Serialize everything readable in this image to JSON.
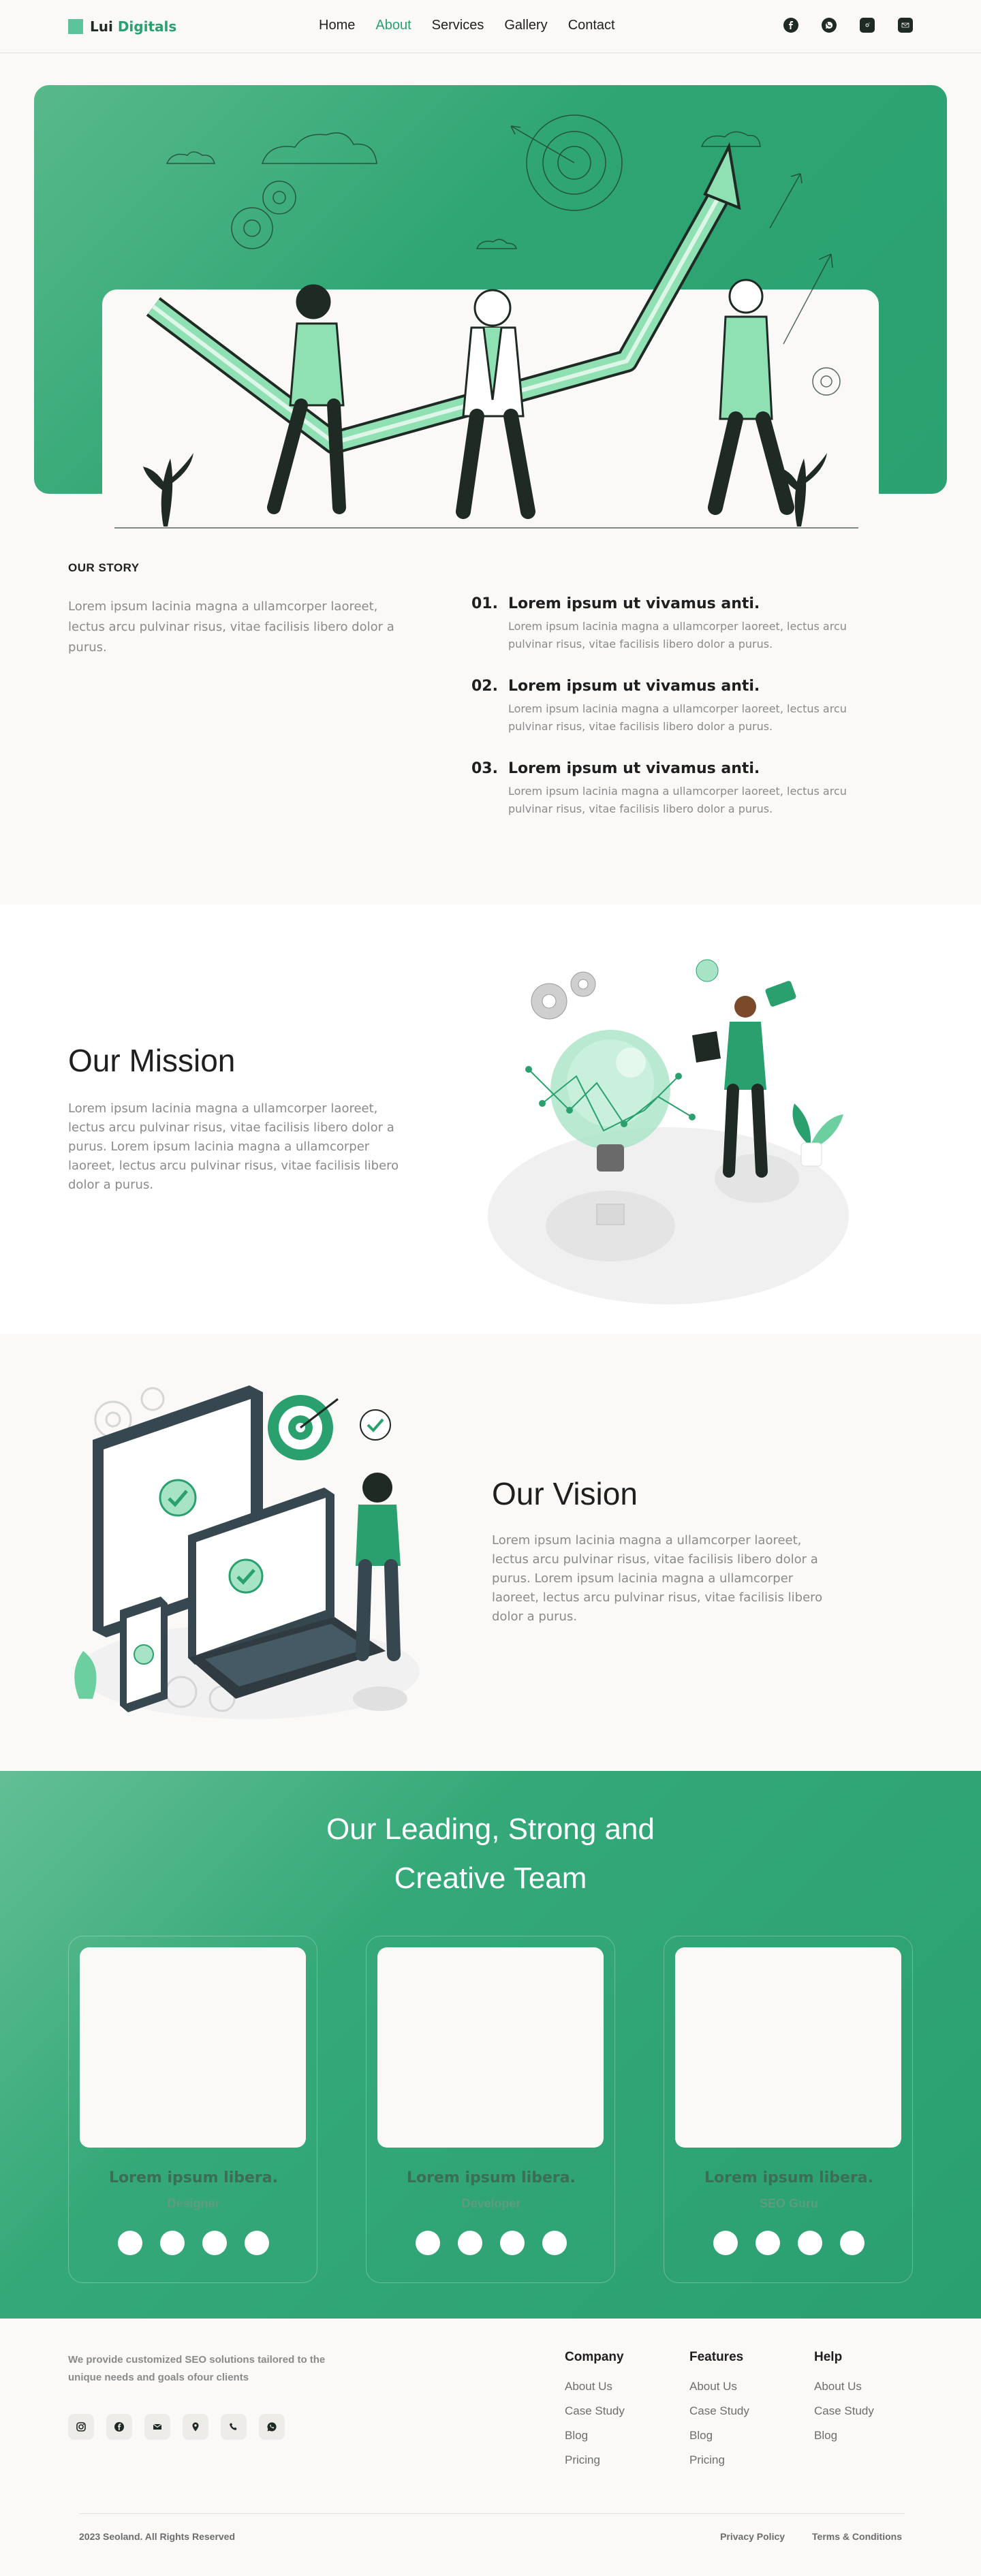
{
  "nav": {
    "logo_prefix": "Lui ",
    "logo_suffix": "Digitals",
    "links": [
      "Home",
      "About",
      "Services",
      "Gallery",
      "Contact"
    ],
    "active": "About",
    "social_icons": [
      "facebook-icon",
      "whatsapp-icon",
      "instagram-icon",
      "mail-icon"
    ]
  },
  "story": {
    "eyebrow": "OUR STORY",
    "text": "Lorem ipsum lacinia magna a ullamcorper laoreet, lectus arcu pulvinar risus, vitae facilisis libero dolor a purus.",
    "items": [
      {
        "num": "01.",
        "title": "Lorem ipsum ut vivamus anti.",
        "body": "Lorem ipsum lacinia magna a ullamcorper laoreet, lectus arcu pulvinar risus, vitae facilisis libero dolor a purus."
      },
      {
        "num": "02.",
        "title": "Lorem ipsum ut vivamus anti.",
        "body": "Lorem ipsum lacinia magna a ullamcorper laoreet, lectus arcu pulvinar risus, vitae facilisis libero dolor a purus."
      },
      {
        "num": "03.",
        "title": "Lorem ipsum ut vivamus anti.",
        "body": "Lorem ipsum lacinia magna a ullamcorper laoreet, lectus arcu pulvinar risus, vitae facilisis libero dolor a purus."
      }
    ]
  },
  "mission": {
    "title": "Our Mission",
    "text": "Lorem ipsum lacinia magna a ullamcorper laoreet, lectus arcu pulvinar risus, vitae facilisis libero dolor a purus. Lorem ipsum lacinia magna a ullamcorper laoreet, lectus arcu pulvinar risus, vitae facilisis libero dolor a purus."
  },
  "vision": {
    "title": "Our Vision",
    "text": "Lorem ipsum lacinia magna a ullamcorper laoreet, lectus arcu pulvinar risus, vitae facilisis libero dolor a purus. Lorem ipsum lacinia magna a ullamcorper laoreet, lectus arcu pulvinar risus, vitae facilisis libero dolor a purus."
  },
  "team": {
    "title_line1": "Our Leading, Strong and",
    "title_line2": "Creative Team",
    "members": [
      {
        "name": "Lorem ipsum libera.",
        "role": "Designer"
      },
      {
        "name": "Lorem ipsum libera.",
        "role": "Developer"
      },
      {
        "name": "Lorem ipsum libera.",
        "role": "SEO Guru"
      }
    ]
  },
  "footer": {
    "tagline": "We provide customized SEO solutions tailored to the unique needs and goals ofour clients",
    "icons": [
      "instagram-icon",
      "facebook-icon",
      "mail-icon",
      "location-icon",
      "phone-icon",
      "whatsapp-icon"
    ],
    "columns": [
      {
        "title": "Company",
        "links": [
          "About Us",
          "Case Study",
          "Blog",
          "Pricing"
        ]
      },
      {
        "title": "Features",
        "links": [
          "About Us",
          "Case Study",
          "Blog",
          "Pricing"
        ]
      },
      {
        "title": "Help",
        "links": [
          "About Us",
          "Case Study",
          "Blog"
        ]
      }
    ],
    "copyright": "2023 Seoland. All Rights Reserved",
    "legal": [
      "Privacy Policy",
      "Terms & Conditions"
    ]
  },
  "colors": {
    "accent": "#2aa06f",
    "accent_light": "#5dc39a",
    "dark": "#1f2a24",
    "text_muted": "#8a8a8a",
    "background": "#faf9f7"
  }
}
